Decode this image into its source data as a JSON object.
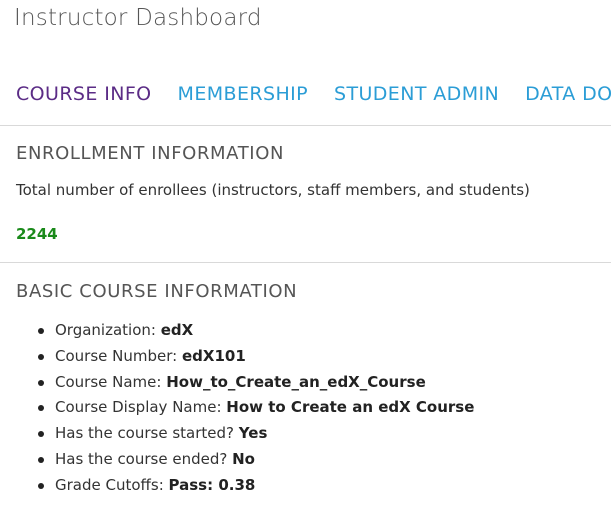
{
  "header": {
    "title": "Instructor Dashboard"
  },
  "tabs": [
    {
      "label": "COURSE INFO",
      "active": true
    },
    {
      "label": "MEMBERSHIP",
      "active": false
    },
    {
      "label": "STUDENT ADMIN",
      "active": false
    },
    {
      "label": "DATA DO",
      "active": false
    }
  ],
  "enrollment": {
    "heading": "ENROLLMENT INFORMATION",
    "description": "Total number of enrollees (instructors, staff members, and students)",
    "count": "2244"
  },
  "basic_info": {
    "heading": "BASIC COURSE INFORMATION",
    "items": [
      {
        "label": "Organization:",
        "value": "edX"
      },
      {
        "label": "Course Number:",
        "value": "edX101"
      },
      {
        "label": "Course Name:",
        "value": "How_to_Create_an_edX_Course"
      },
      {
        "label": "Course Display Name:",
        "value": "How to Create an edX Course"
      },
      {
        "label": "Has the course started?",
        "value": "Yes"
      },
      {
        "label": "Has the course ended?",
        "value": "No"
      },
      {
        "label": "Grade Cutoffs:",
        "value": "Pass: 0.38"
      }
    ]
  },
  "colors": {
    "tab_active": "#5b2c86",
    "tab_inactive": "#2b9dd6",
    "enroll_count": "#1a8a1a"
  }
}
